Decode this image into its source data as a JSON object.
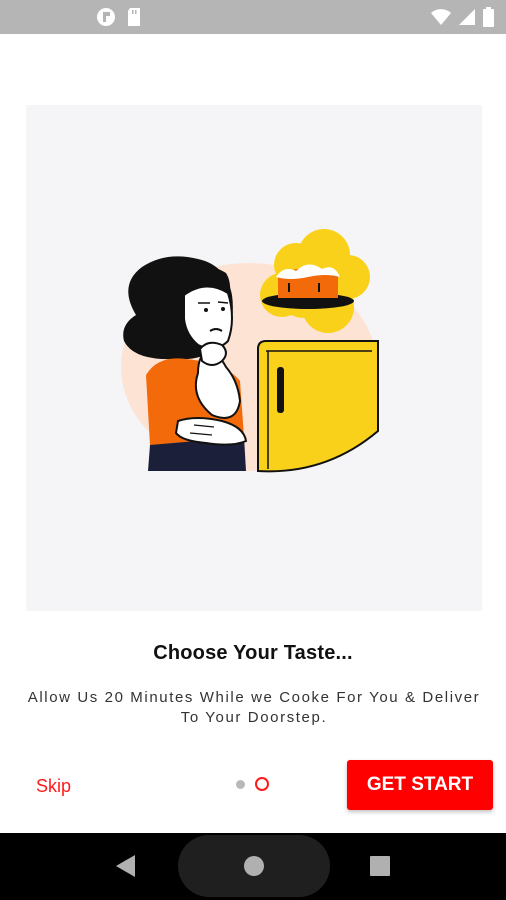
{
  "status_bar": {
    "left_icons": [
      "notification-icon",
      "sd-card-icon"
    ],
    "right_icons": [
      "wifi-icon",
      "signal-icon",
      "battery-icon"
    ]
  },
  "illustration": {
    "icon": "thinking-woman-fridge-cake-illustration",
    "colors": {
      "card_bg": "#f5f5f7",
      "fridge": "#f9d11a",
      "shirt": "#f26a0a",
      "blob": "#fde3d3"
    }
  },
  "onboarding": {
    "title": "Choose Your Taste...",
    "subtitle": "Allow Us 20 Minutes While we Cooke For You & Deliver To Your Doorstep.",
    "skip_label": "Skip",
    "cta_label": "GET START",
    "page_count": 2,
    "current_page": 2
  },
  "nav_bar": {
    "icons": [
      "back-icon",
      "home-icon",
      "recents-icon"
    ]
  },
  "colors": {
    "accent": "#ff0000",
    "status_bar": "#b5b5b5",
    "nav_bar": "#000000"
  }
}
